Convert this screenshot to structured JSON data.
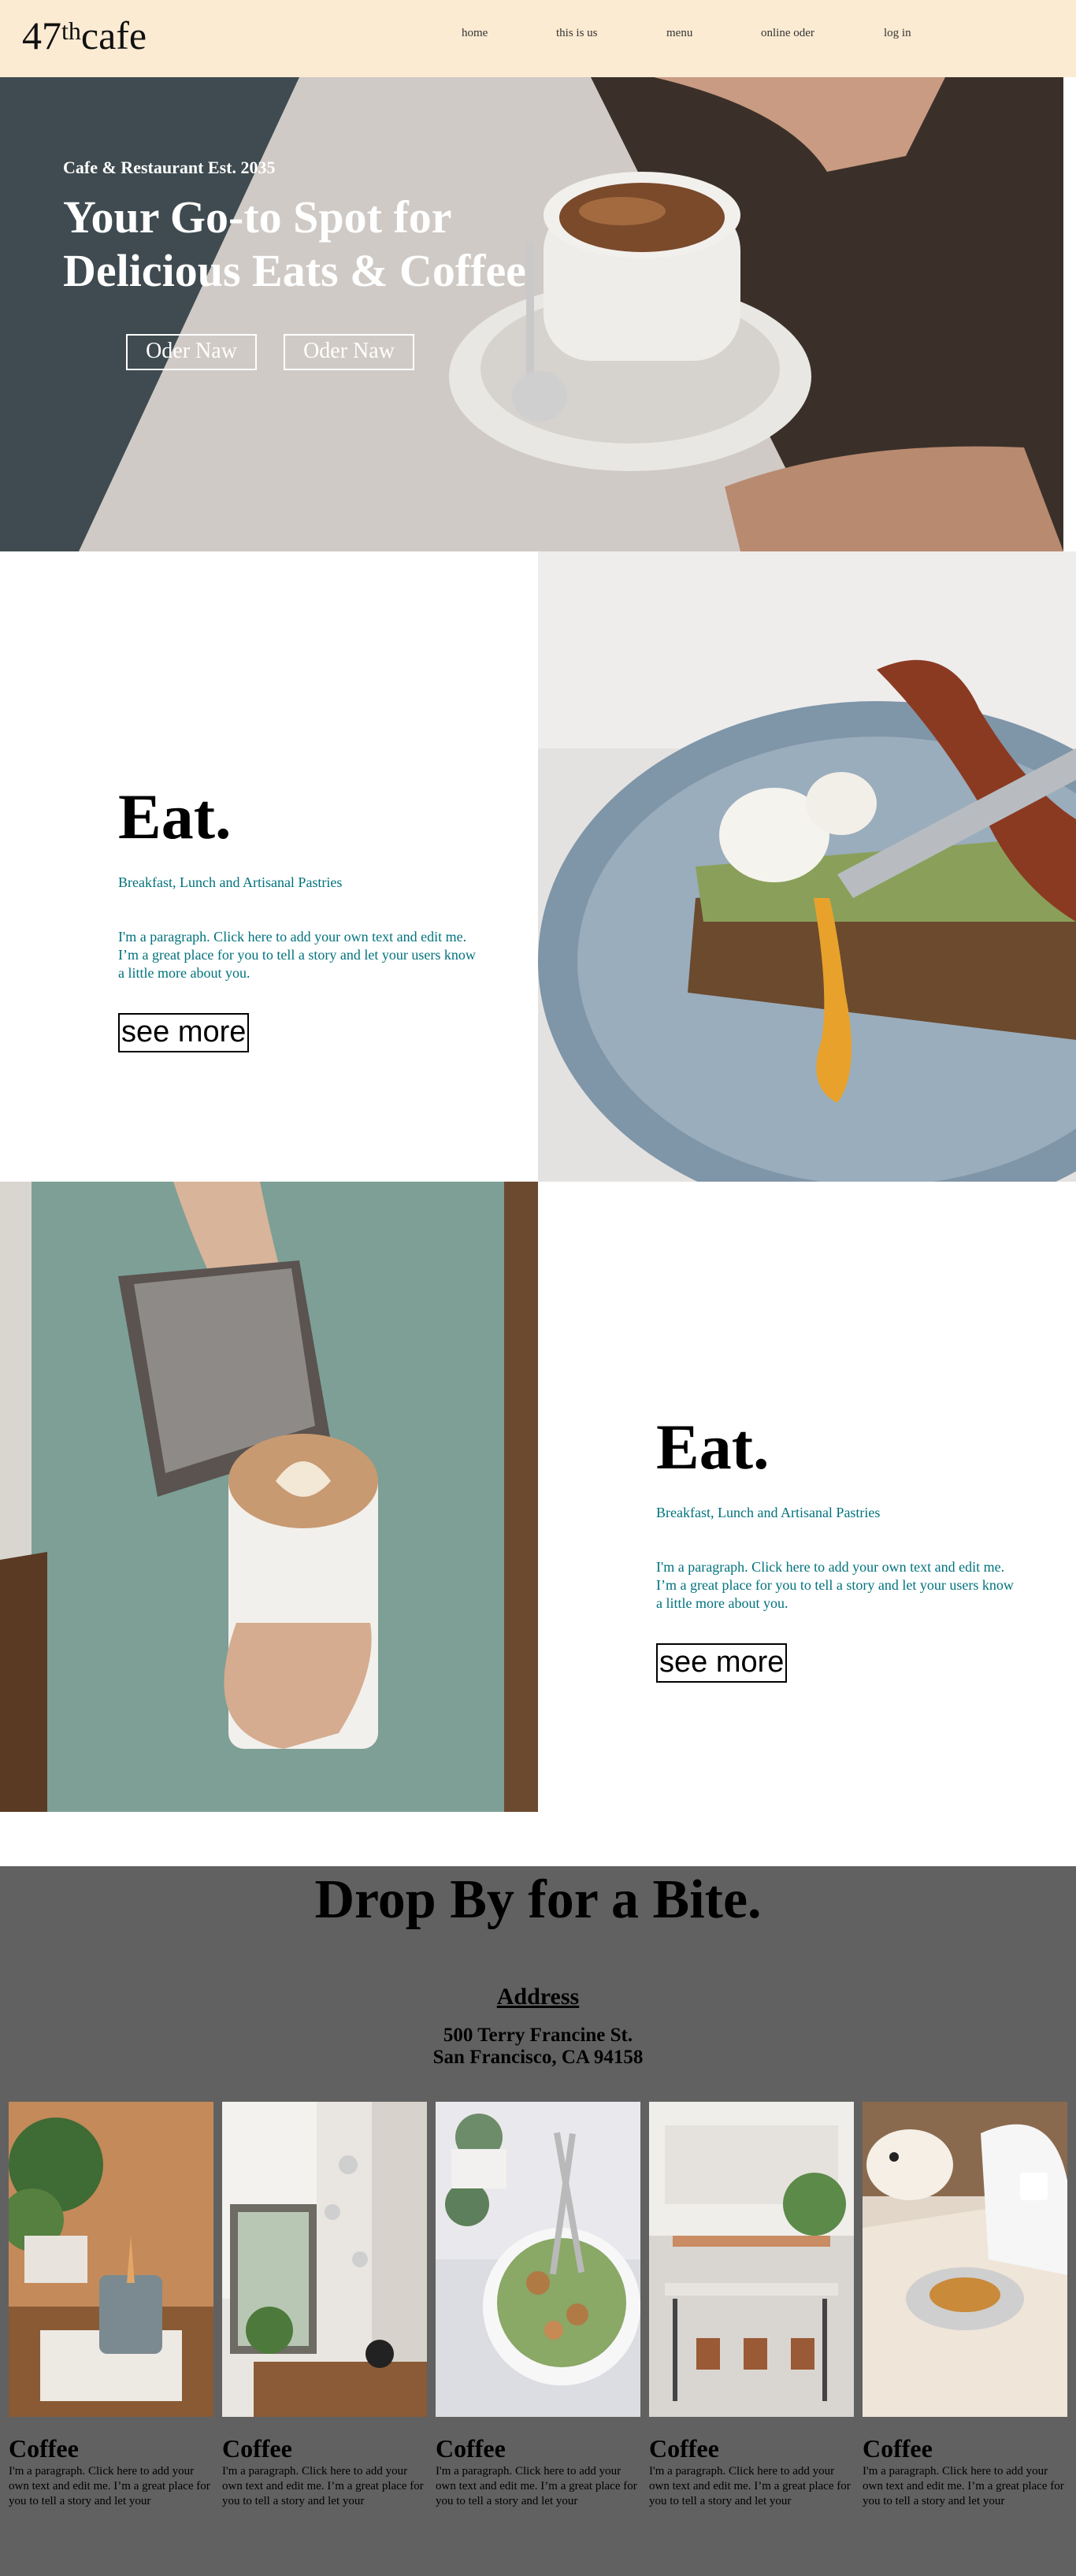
{
  "brand": {
    "logo_main": "47",
    "logo_sup": "th",
    "logo_rest": "cafe"
  },
  "nav": {
    "home": "home",
    "about": "this is us",
    "menu": "menu",
    "order": "online oder",
    "login": "log in"
  },
  "hero": {
    "est": "Cafe & Restaurant Est. 2035",
    "title": "Your Go-to Spot for Delicious Eats & Coffee",
    "button1": "Oder Naw",
    "button2": "Oder Naw"
  },
  "eat1": {
    "heading": "Eat.",
    "subtitle": "Breakfast, Lunch and Artisanal Pastries",
    "paragraph": "I'm a paragraph. Click here to add your own text and edit me. I’m a great place for you to tell a story and let your users know a little more about you.",
    "button": "see more"
  },
  "eat2": {
    "heading": "Eat.",
    "subtitle": "Breakfast, Lunch and Artisanal Pastries",
    "paragraph": "I'm a paragraph. Click here to add your own text and edit me. I’m a great place for you to tell a story and let your users know a little more about you.",
    "button": "see more"
  },
  "visit": {
    "title": "Drop By for a Bite.",
    "address_label": "Address",
    "address_line1": "500 Terry Francine St.",
    "address_line2": "San Francisco, CA 94158"
  },
  "cards": [
    {
      "title": "Coffee",
      "text": "I'm a paragraph. Click here to add your own text and edit me. I’m a great place for you to tell a story and let your"
    },
    {
      "title": "Coffee",
      "text": "I'm a paragraph. Click here to add your own text and edit me. I’m a great place for you to tell a story and let your"
    },
    {
      "title": "Coffee",
      "text": "I'm a paragraph. Click here to add your own text and edit me. I’m a great place for you to tell a story and let your"
    },
    {
      "title": "Coffee",
      "text": "I'm a paragraph. Click here to add your own text and edit me. I’m a great place for you to tell a story and let your"
    },
    {
      "title": "Coffee",
      "text": "I'm a paragraph. Click here to add your own text and edit me. I’m a great place for you to tell a story and let your"
    }
  ],
  "colors": {
    "header_bg": "#fcebd3",
    "accent_teal": "#00727d",
    "visit_bg": "#616161"
  }
}
